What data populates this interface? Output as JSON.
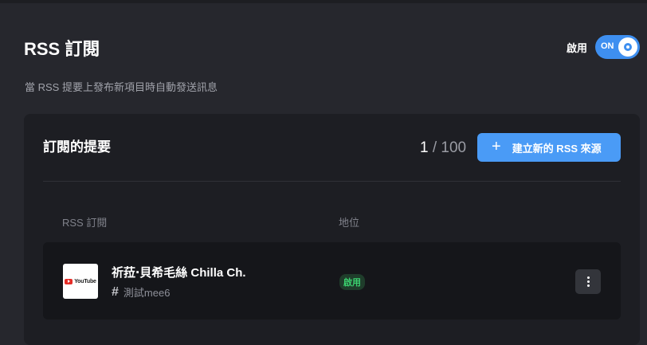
{
  "header": {
    "title": "RSS 訂閱",
    "subtitle": "當 RSS 提要上發布新項目時自動發送訊息",
    "enable_label": "啟用",
    "toggle_text": "ON",
    "toggle_on": true
  },
  "panel": {
    "title": "訂閱的提要",
    "counter_current": "1",
    "counter_sep": " / ",
    "counter_max": "100",
    "create_button_icon": "plus-icon",
    "create_button_label": "建立新的 RSS 來源",
    "columns": [
      "RSS 訂閱",
      "地位"
    ],
    "rows": [
      {
        "thumbnail_text": "YouTube",
        "feed_name": "祈菈‧貝希毛絲 Chilla Ch.",
        "channel": "測試mee6",
        "status": "啟用"
      }
    ]
  },
  "colors": {
    "accent": "#4a9bf6",
    "status_green": "#3bd16f",
    "background": "#26272d",
    "panel": "#1d1e23"
  }
}
